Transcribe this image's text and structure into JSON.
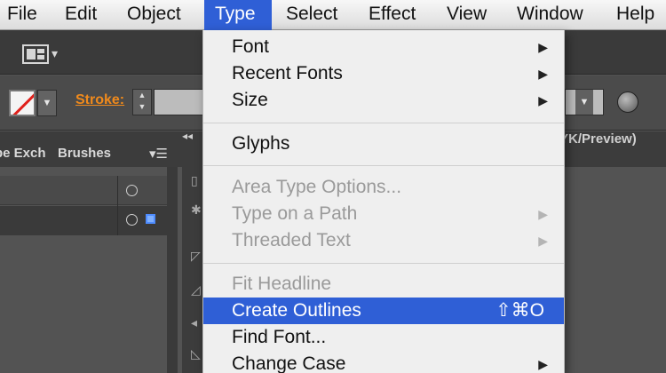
{
  "menubar": {
    "items": [
      "File",
      "Edit",
      "Object",
      "Type",
      "Select",
      "Effect",
      "View",
      "Window",
      "Help"
    ],
    "active": "Type"
  },
  "control_bar": {
    "stroke_label": "Stroke:"
  },
  "panels": {
    "tabs": [
      "pe Exch",
      "Brushes"
    ],
    "document_tab": "YK/Preview)"
  },
  "type_menu": {
    "items": [
      {
        "label": "Font",
        "submenu": true,
        "enabled": true
      },
      {
        "label": "Recent Fonts",
        "submenu": true,
        "enabled": true
      },
      {
        "label": "Size",
        "submenu": true,
        "enabled": true
      },
      {
        "label": "Glyphs",
        "submenu": false,
        "enabled": true
      },
      {
        "label": "Area Type Options...",
        "submenu": false,
        "enabled": false
      },
      {
        "label": "Type on a Path",
        "submenu": true,
        "enabled": false
      },
      {
        "label": "Threaded Text",
        "submenu": true,
        "enabled": false
      },
      {
        "label": "Fit Headline",
        "submenu": false,
        "enabled": false
      },
      {
        "label": "Create Outlines",
        "submenu": false,
        "enabled": true,
        "highlighted": true,
        "shortcut": "⇧⌘O"
      },
      {
        "label": "Find Font...",
        "submenu": false,
        "enabled": true
      },
      {
        "label": "Change Case",
        "submenu": true,
        "enabled": true
      }
    ],
    "submenu_arrow": "▶"
  },
  "colors": {
    "highlight": "#2f5fd6",
    "stroke_label": "#f08a1c",
    "no_fill_slash": "#e0201b"
  }
}
